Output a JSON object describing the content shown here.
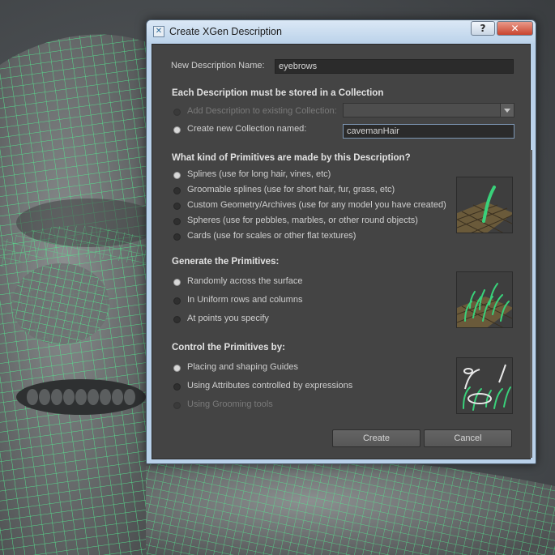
{
  "dialog": {
    "title": "Create XGen Description",
    "icon": "xgen-app-icon",
    "help_label": "?",
    "close_label": "✕"
  },
  "name_row": {
    "label": "New Description Name:",
    "value": "eyebrows"
  },
  "collection": {
    "heading": "Each Description must be stored in a Collection",
    "existing_label": "Add Description to existing Collection:",
    "existing_value": "",
    "new_label": "Create new Collection named:",
    "new_value": "cavemanHair",
    "selected": "new"
  },
  "primitives": {
    "heading": "What kind of Primitives are made by this Description?",
    "options": [
      "Splines (use for long hair, vines, etc)",
      "Groomable splines (use for short hair, fur, grass, etc)",
      "Custom Geometry/Archives (use for any model you have created)",
      "Spheres (use for pebbles, marbles, or other round objects)",
      "Cards (use for scales or other flat textures)"
    ],
    "selected_index": 0
  },
  "generate": {
    "heading": "Generate the Primitives:",
    "options": [
      "Randomly across the surface",
      "In Uniform rows and columns",
      "At points you specify"
    ],
    "selected_index": 0
  },
  "control": {
    "heading": "Control the Primitives by:",
    "options": [
      "Placing and shaping Guides",
      "Using Attributes controlled by expressions",
      "Using Grooming tools"
    ],
    "selected_index": 0,
    "disabled_index": 2
  },
  "buttons": {
    "create": "Create",
    "cancel": "Cancel"
  },
  "colors": {
    "wire": "#56e890",
    "panel": "#444444",
    "titlebar": "#bcd3ea"
  }
}
